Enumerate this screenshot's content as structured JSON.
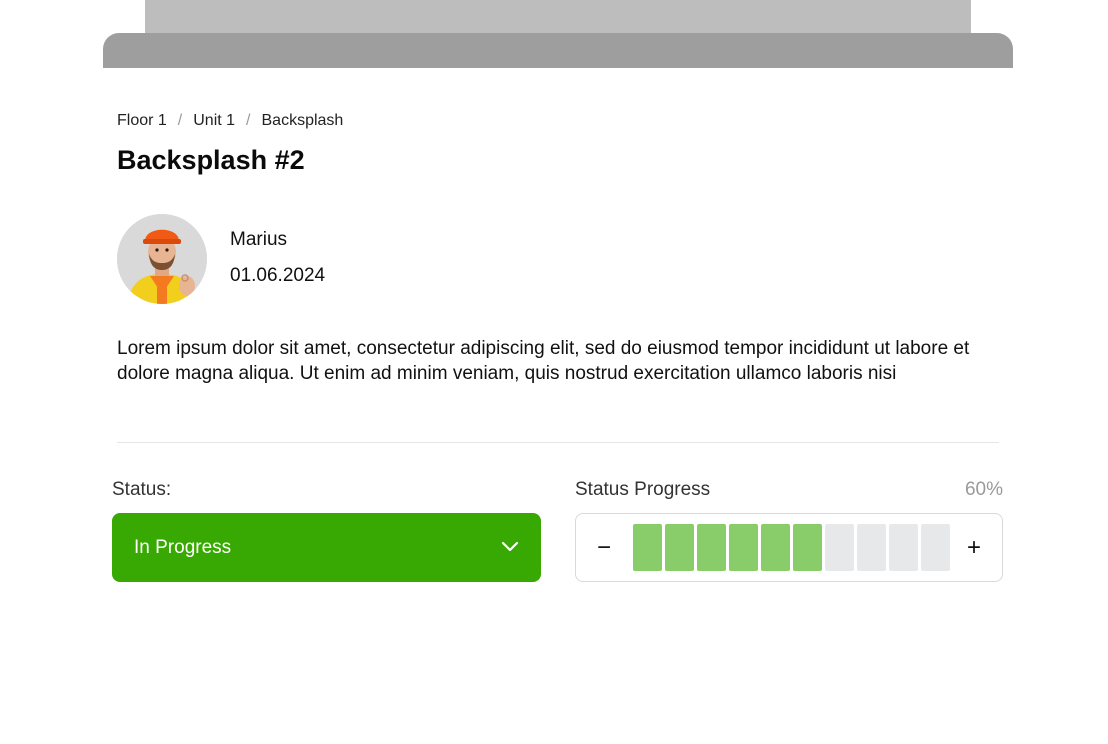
{
  "breadcrumb": {
    "items": [
      "Floor 1",
      "Unit 1",
      "Backsplash"
    ],
    "separator": "/"
  },
  "page": {
    "title": "Backsplash #2"
  },
  "author": {
    "name": "Marius",
    "date": "01.06.2024",
    "avatar_icon": "worker-avatar"
  },
  "description": "Lorem ipsum dolor sit amet, consectetur adipiscing elit, sed do eiusmod tempor incididunt ut labore et dolore magna aliqua. Ut enim ad minim veniam, quis nostrud exercitation ullamco laboris nisi",
  "status": {
    "label": "Status:",
    "value": "In Progress",
    "color": "#38a903",
    "icon": "chevron-down-icon"
  },
  "progress": {
    "label": "Status Progress",
    "percent_text": "60%",
    "total_segments": 10,
    "filled_segments": 6,
    "minus_label": "−",
    "plus_label": "+",
    "filled_color": "#88cd6a",
    "empty_color": "#e6e8ea"
  }
}
